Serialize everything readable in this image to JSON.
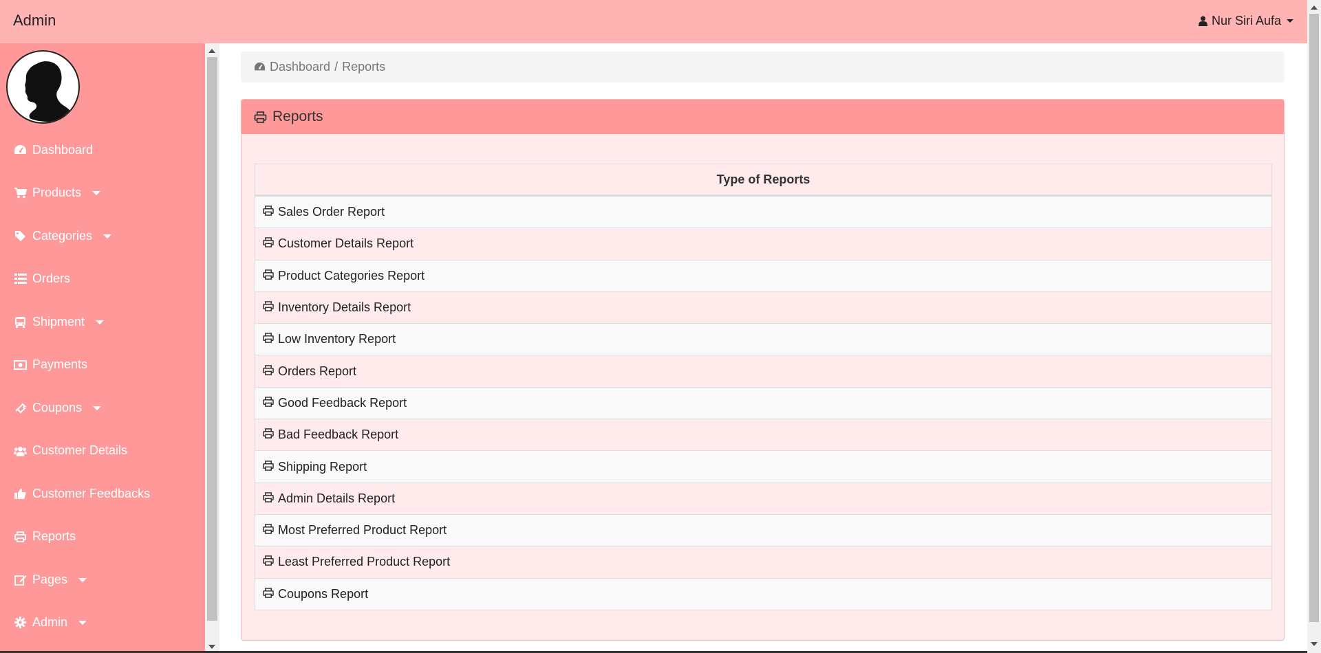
{
  "header": {
    "brand": "Admin",
    "user_name": "Nur Siri Aufa"
  },
  "sidebar": {
    "items": [
      {
        "label": "Dashboard",
        "icon": "dashboard-icon",
        "has_caret": false
      },
      {
        "label": "Products",
        "icon": "cart-icon",
        "has_caret": true
      },
      {
        "label": "Categories",
        "icon": "tag-icon",
        "has_caret": true
      },
      {
        "label": "Orders",
        "icon": "list-icon",
        "has_caret": false
      },
      {
        "label": "Shipment",
        "icon": "bus-icon",
        "has_caret": true
      },
      {
        "label": "Payments",
        "icon": "money-icon",
        "has_caret": false
      },
      {
        "label": "Coupons",
        "icon": "ticket-icon",
        "has_caret": true
      },
      {
        "label": "Customer Details",
        "icon": "users-icon",
        "has_caret": false
      },
      {
        "label": "Customer Feedbacks",
        "icon": "thumbs-up-icon",
        "has_caret": false
      },
      {
        "label": "Reports",
        "icon": "print-icon",
        "has_caret": false
      },
      {
        "label": "Pages",
        "icon": "edit-icon",
        "has_caret": true
      },
      {
        "label": "Admin",
        "icon": "gear-icon",
        "has_caret": true
      }
    ]
  },
  "breadcrumb": {
    "dashboard": "Dashboard",
    "separator": "/",
    "current": "Reports"
  },
  "panel": {
    "title": "Reports",
    "table_header": "Type of Reports",
    "reports": [
      "Sales Order Report",
      "Customer Details Report",
      "Product Categories Report",
      "Inventory Details Report",
      "Low Inventory Report",
      "Orders Report",
      "Good Feedback Report",
      "Bad Feedback Report",
      "Shipping Report",
      "Admin Details Report",
      "Most Preferred Product Report",
      "Least Preferred Product Report",
      "Coupons Report"
    ]
  },
  "colors": {
    "topbar": "#ffb3b3",
    "sidebar": "#ff9999",
    "panel_heading": "#ff9999",
    "panel_body": "#ffebeb"
  }
}
